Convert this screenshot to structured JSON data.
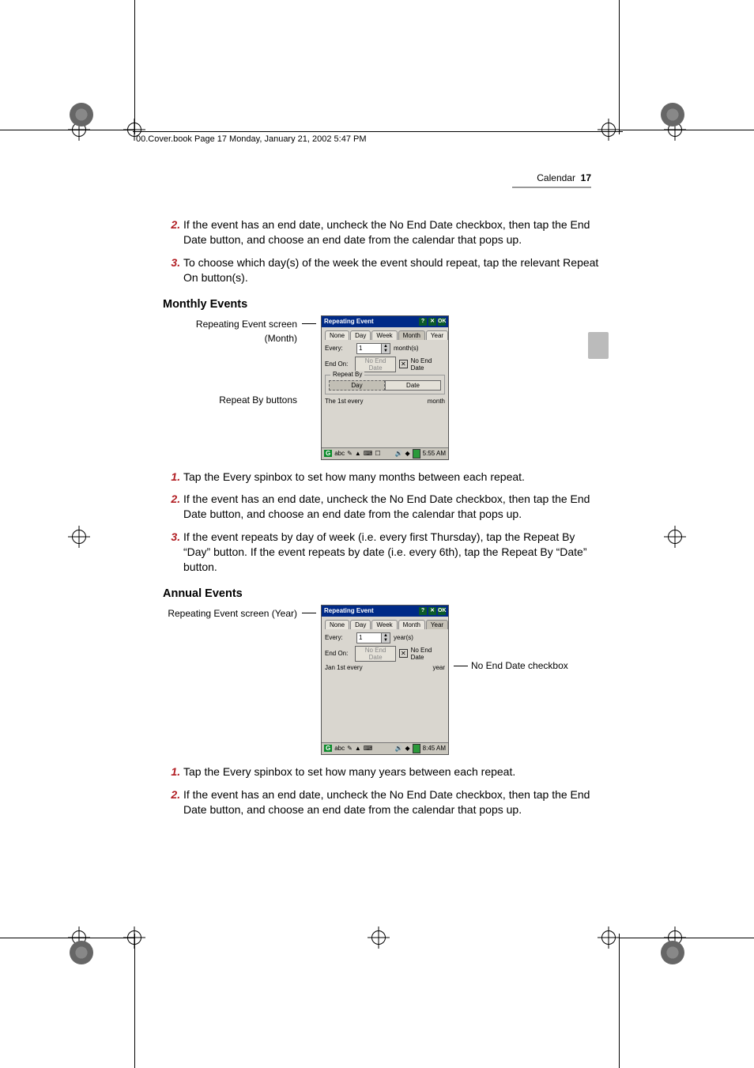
{
  "print_header": "00.Cover.book  Page 17  Monday, January 21, 2002  5:47 PM",
  "running_head": {
    "section": "Calendar",
    "page": "17"
  },
  "intro_steps": {
    "s2": "If the event has an end date, uncheck the No End Date checkbox, then tap the End Date button, and choose an end date from the calendar that pops up.",
    "s3": "To choose which day(s) of the week the event should repeat, tap the relevant Repeat On button(s)."
  },
  "monthly": {
    "heading": "Monthly Events",
    "callout1": "Repeating Event screen (Month)",
    "callout2": "Repeat By buttons",
    "steps": {
      "s1": "Tap the Every spinbox to set how many months between each repeat.",
      "s2": "If the event has an end date, uncheck the No End Date checkbox, then tap the End Date button, and choose an end date from the calendar that pops up.",
      "s3": "If the event repeats by day of week (i.e. every first Thursday), tap the Repeat By “Day” button. If the event repeats by date (i.e. every 6th), tap the Repeat By “Date” button."
    }
  },
  "annual": {
    "heading": "Annual Events",
    "callout1": "Repeating Event screen (Year)",
    "callout_right": "No End Date checkbox",
    "steps": {
      "s1": "Tap the Every spinbox to set how many years between each repeat.",
      "s2": "If the event has an end date, uncheck the No End Date checkbox, then tap the End Date button, and choose an end date from the calendar that pops up."
    }
  },
  "pda": {
    "title": "Repeating Event",
    "tabs": {
      "none": "None",
      "day": "Day",
      "week": "Week",
      "month": "Month",
      "year": "Year"
    },
    "every_label": "Every:",
    "every_value": "1",
    "unit_month": "month(s)",
    "unit_year": "year(s)",
    "end_label": "End On:",
    "end_btn": "No End Date",
    "no_end": "No End Date",
    "repeat_by": "Repeat By",
    "seg_day": "Day",
    "seg_date": "Date",
    "desc_month_left": "The 1st every",
    "desc_month_right": "month",
    "desc_year_left": "Jan 1st every",
    "desc_year_right": "year",
    "task_g": "G",
    "task_abc": "abc",
    "time1": "5:55 AM",
    "time2": "8:45 AM"
  }
}
